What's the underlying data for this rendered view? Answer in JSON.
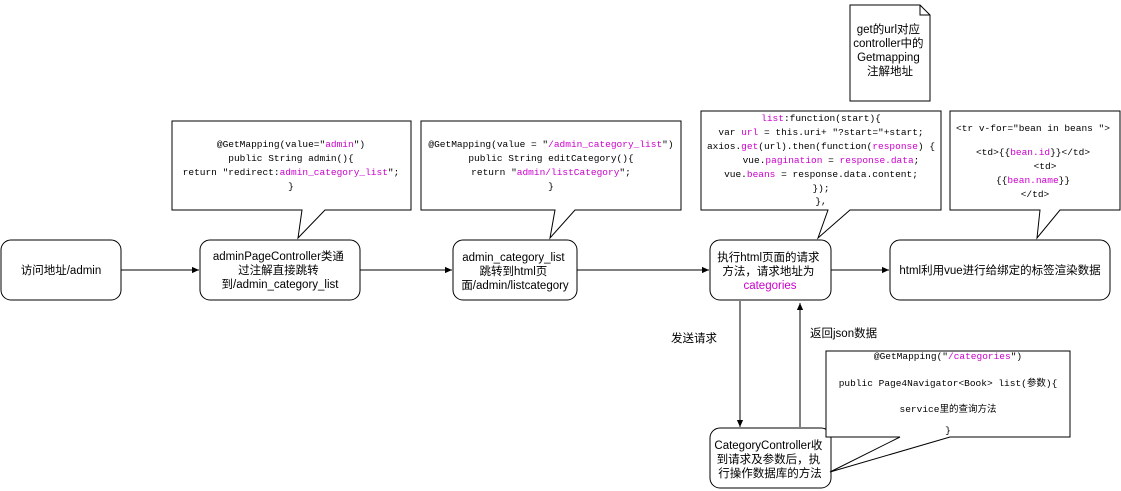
{
  "nodes": {
    "visit": "访问地址/admin",
    "admin_page_controller": [
      "adminPageController类通",
      "过注解直接跳转",
      "到/admin_category_list"
    ],
    "admin_category_list": [
      "admin_category_list",
      "跳转到html页",
      "面/admin/listcategory"
    ],
    "exec_request": {
      "line1": "执行html页面的请求",
      "line2": "方法，请求地址为",
      "line3": "categories"
    },
    "render": "html利用vue进行给绑定的标签渲染数据",
    "category_controller": [
      "CategoryController收",
      "到请求及参数后，执",
      "行操作数据库的方法"
    ]
  },
  "edge_labels": {
    "send_request": "发送请求",
    "return_json": "返回json数据"
  },
  "notes": {
    "get_url": [
      "get的url对应",
      "controller中的",
      "Getmapping",
      "注解地址"
    ]
  },
  "code": {
    "admin_mapping": {
      "l1a": "@GetMapping(value=\"",
      "l1b": "admin",
      "l1c": "\")",
      "l2": "public String admin(){",
      "l3a": "return \"redirect:",
      "l3b": "admin_category_list",
      "l3c": "\";",
      "l4": "}"
    },
    "list_mapping": {
      "l1a": "@GetMapping(value = \"",
      "l1b": "/admin_category_list",
      "l1c": "\")",
      "l2": "public String editCategory(){",
      "l3a": "return \"",
      "l3b": "admin/listCategory",
      "l3c": "\";",
      "l4": "}"
    },
    "vue_list": {
      "l1a": "list",
      "l1b": ":function(start){",
      "l2a": "var ",
      "l2b": "url",
      "l2c": " =  this.uri+ \"?start=\"+start;",
      "l3a": "axios.",
      "l3b": "get",
      "l3c": "(url).then(function(",
      "l3d": "response",
      "l3e": ")  {",
      "l4a": "vue.",
      "l4b": "pagination",
      "l4c": " = ",
      "l4d": "response.data",
      "l4e": ";",
      "l5a": "vue.",
      "l5b": "beans",
      "l5c": " = response.data.content;",
      "l6": "});",
      "l7": "},"
    },
    "template": {
      "l1": "<tr  v-for=\"bean in beans \">",
      "l2a": "<td>{{",
      "l2b": "bean.id",
      "l2c": "}}</td>",
      "l3": "<td>",
      "l4a": "{{",
      "l4b": "bean.name",
      "l4c": "}}",
      "l5": "</td>"
    },
    "categories_mapping": {
      "l1a": "@GetMapping(\"",
      "l1b": "/categories",
      "l1c": "\")",
      "l2a": "public Page4Navigator<Book> ",
      "l2b": "list(参数){",
      "l3a": "service",
      "l3b": "里的查询方法",
      "l4": "}"
    }
  }
}
